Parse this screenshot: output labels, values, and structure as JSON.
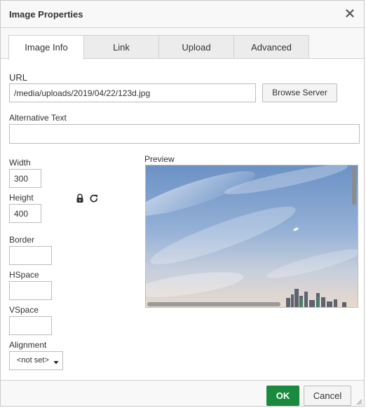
{
  "dialog": {
    "title": "Image Properties",
    "close_icon": "close-icon"
  },
  "tabs": [
    {
      "label": "Image Info",
      "active": true
    },
    {
      "label": "Link",
      "active": false
    },
    {
      "label": "Upload",
      "active": false
    },
    {
      "label": "Advanced",
      "active": false
    }
  ],
  "form": {
    "url_label": "URL",
    "url_value": "/media/uploads/2019/04/22/123d.jpg",
    "browse_button": "Browse Server",
    "alt_label": "Alternative Text",
    "alt_value": "",
    "width_label": "Width",
    "width_value": "300",
    "height_label": "Height",
    "height_value": "400",
    "lock_icon": "lock-icon",
    "reset_icon": "reset-size-icon",
    "border_label": "Border",
    "border_value": "",
    "hspace_label": "HSpace",
    "hspace_value": "",
    "vspace_label": "VSpace",
    "vspace_value": "",
    "alignment_label": "Alignment",
    "alignment_value": "<not set>",
    "preview_label": "Preview"
  },
  "footer": {
    "ok_label": "OK",
    "cancel_label": "Cancel"
  },
  "colors": {
    "ok_button": "#1b8a3f",
    "sky_top": "#6d93c7",
    "sky_bottom": "#e6d8cd"
  }
}
